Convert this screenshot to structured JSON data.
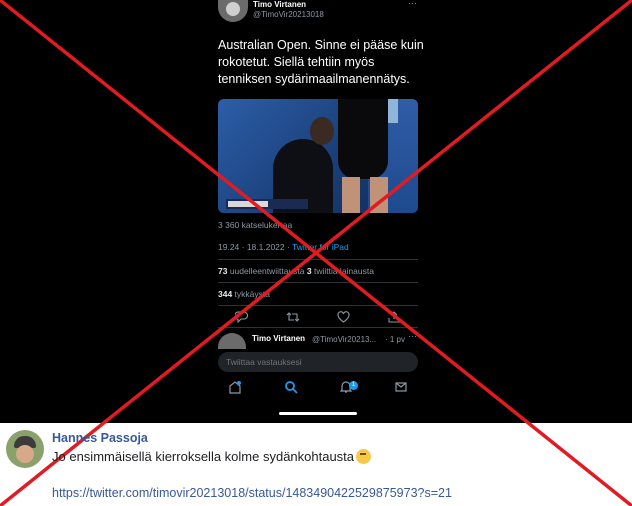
{
  "tweet": {
    "author_name": "Timo Virtanen",
    "author_handle": "@TimoVir20213018",
    "more_glyph": "···",
    "text": "Australian Open. Sinne ei pääse kuin rokotetut. Siellä tehtiin myös tenniksen sydärimaailmanennätys.",
    "views": "3 360 katselukertaa",
    "time": "19.24 · 18.1.2022 · ",
    "source": "Twitter for iPad",
    "retweets_count": "73",
    "retweets_label": " uudelleentwiittausta ",
    "quotes_count": "3",
    "quotes_label": " twiittiä lainausta",
    "likes_count": "344",
    "likes_label": " tykkäystä"
  },
  "actions": {
    "reply_icon": "reply-icon",
    "retweet_icon": "retweet-icon",
    "like_icon": "heart-icon",
    "share_icon": "share-icon"
  },
  "reply": {
    "author_name": "Timo Virtanen",
    "author_handle": "@TimoVir20213...",
    "time": "· 1 pv",
    "more_glyph": "···",
    "placeholder": "Twiittaa vastauksesi"
  },
  "nav": {
    "notification_count": "1"
  },
  "overlay": {
    "cross_color": "#e21b23"
  },
  "facebook_post": {
    "author": "Hannes Passoja",
    "text": "Jo ensimmäisellä kierroksella kolme sydänkohtausta",
    "link": "https://twitter.com/timovir20213018/status/1483490422529875973?s=21"
  },
  "colors": {
    "link": "#385898",
    "twitter_blue": "#1d9bf0"
  }
}
